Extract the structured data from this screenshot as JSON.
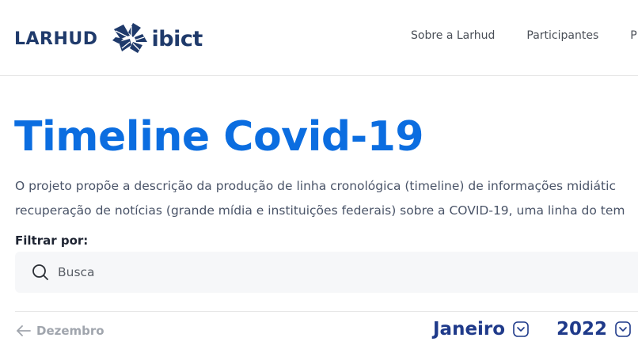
{
  "header": {
    "brand": "LARHUD",
    "partner_logo_text": "ibict",
    "nav": [
      {
        "label": "Sobre a Larhud"
      },
      {
        "label": "Participantes"
      },
      {
        "label": "P"
      }
    ]
  },
  "main": {
    "title": "Timeline Covid-19",
    "description": [
      "O projeto propõe a descrição da produção de linha cronológica (timeline) de informações midiátic",
      "recuperação de notícias (grande mídia e instituições federais) sobre a COVID-19, uma linha do tem"
    ],
    "filter_label": "Filtrar por:",
    "search": {
      "placeholder": "Busca",
      "value": ""
    },
    "timeline_nav": {
      "previous_label": "Dezembro",
      "month": "Janeiro",
      "year": "2022"
    }
  },
  "colors": {
    "accent": "#0b6de0",
    "brand": "#1f3a6b",
    "nav_dark": "#1f3a8a",
    "muted": "#a0a5ad"
  },
  "icons": [
    "ibict-logo-icon",
    "search-icon",
    "arrow-left-icon",
    "chevron-down-icon"
  ]
}
